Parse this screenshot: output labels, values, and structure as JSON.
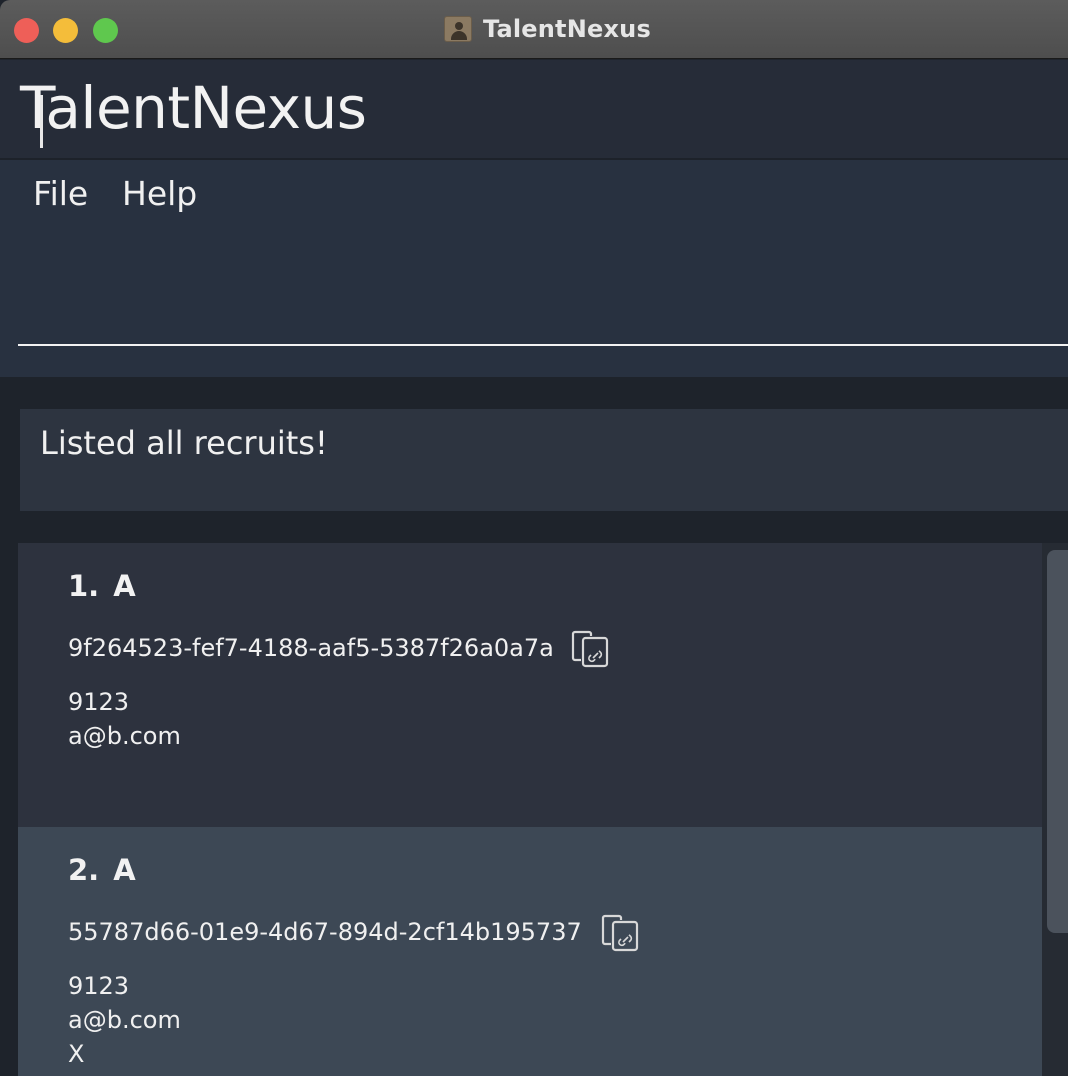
{
  "window": {
    "title": "TalentNexus",
    "app_icon": "contact-card-icon"
  },
  "header": {
    "app_name": "TalentNexus"
  },
  "menu": {
    "items": [
      {
        "label": "File"
      },
      {
        "label": "Help"
      }
    ]
  },
  "command_box": {
    "value": ""
  },
  "result_display": {
    "message": "Listed all recruits!"
  },
  "recruits": [
    {
      "index": "1.",
      "name": "A",
      "id": "9f264523-fef7-4188-aaf5-5387f26a0a7a",
      "phone": "9123",
      "email": "a@b.com",
      "extra": ""
    },
    {
      "index": "2.",
      "name": "A",
      "id": "55787d66-01e9-4d67-894d-2cf14b195737",
      "phone": "9123",
      "email": "a@b.com",
      "extra": "X"
    }
  ],
  "colors": {
    "accent_text": "#f0f0f0",
    "card_odd": "#2d323e",
    "card_even": "#3d4855"
  }
}
